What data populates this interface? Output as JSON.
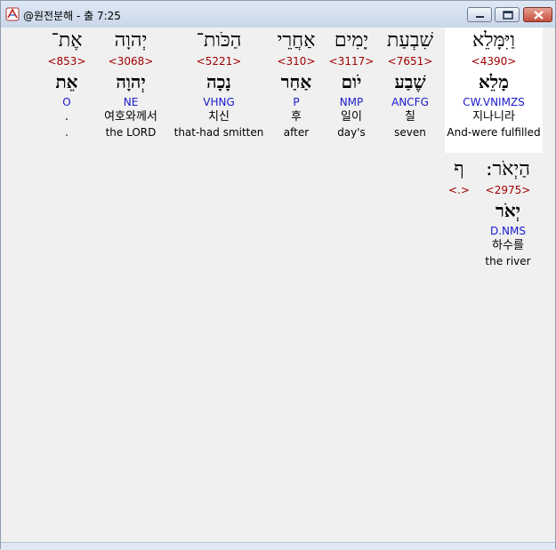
{
  "window": {
    "title": "@원전분해 - 출 7:25"
  },
  "row1": [
    {
      "heb": "וַיִּמָּלֵא",
      "strong": "<4390>",
      "lemma": "מָלֵא",
      "morph": "CW.VNIMZS",
      "korean": "지나니라",
      "english": "And-were fulfilled"
    },
    {
      "heb": "שִׁבְעַת",
      "strong": "<7651>",
      "lemma": "שֶׁבַע",
      "morph": "ANCFG",
      "korean": "칠",
      "english": "seven"
    },
    {
      "heb": "יָמִים",
      "strong": "<3117>",
      "lemma": "יֹום",
      "morph": "NMP",
      "korean": "일이",
      "english": "day's"
    },
    {
      "heb": "אַחֲרֵי",
      "strong": "<310>",
      "lemma": "אַחַר",
      "morph": "P",
      "korean": "후",
      "english": "after"
    },
    {
      "heb": "הַכֹּות־",
      "strong": "<5221>",
      "lemma": "נָכָה",
      "morph": "VHNG",
      "korean": "치신",
      "english": "that-had smitten"
    },
    {
      "heb": "יְהוָה",
      "strong": "<3068>",
      "lemma": "יְהוָה",
      "morph": "NE",
      "korean": "여호와께서",
      "english": "the LORD"
    },
    {
      "heb": "אֶת־",
      "strong": "<853>",
      "lemma": "אֵת",
      "morph": "O",
      "korean": ".",
      "english": "."
    }
  ],
  "row2": [
    {
      "heb": "הַיְאֹר:",
      "strong": "<2975>",
      "lemma": "יְאֹר",
      "morph": "D.NMS",
      "korean": "하수를",
      "english": "the river"
    },
    {
      "heb": "ף",
      "strong": "<.>",
      "lemma": "",
      "morph": "",
      "korean": "",
      "english": ""
    }
  ]
}
